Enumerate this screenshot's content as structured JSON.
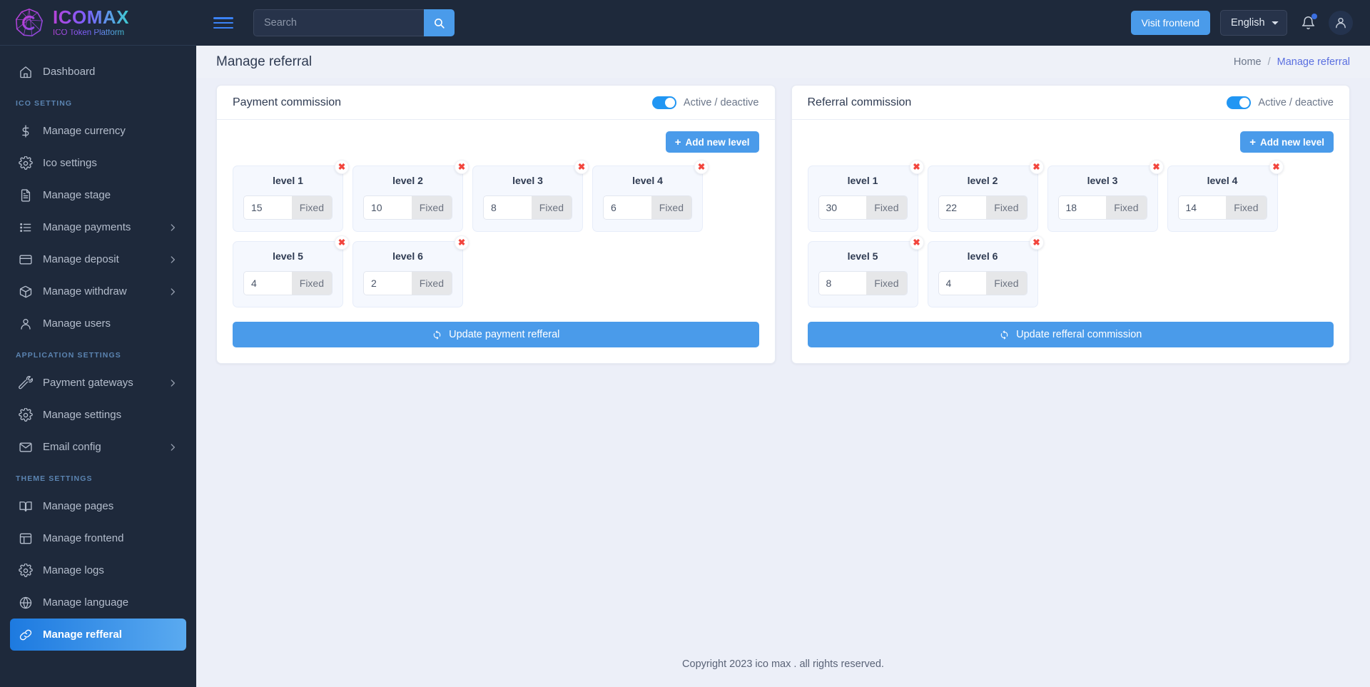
{
  "brand": {
    "title": "ICOMAX",
    "subtitle": "ICO Token Platform",
    "logo_icon": "icomax-gem-logo"
  },
  "sidebar": {
    "items": [
      {
        "label": "Dashboard",
        "icon": "home-icon",
        "type": "item",
        "active": false,
        "caret": false
      },
      {
        "label": "ICO SETTING",
        "type": "section"
      },
      {
        "label": "Manage currency",
        "icon": "dollar-icon",
        "type": "item",
        "active": false,
        "caret": false
      },
      {
        "label": "Ico settings",
        "icon": "gear-icon",
        "type": "item",
        "active": false,
        "caret": false
      },
      {
        "label": "Manage stage",
        "icon": "document-icon",
        "type": "item",
        "active": false,
        "caret": false
      },
      {
        "label": "Manage payments",
        "icon": "list-icon",
        "type": "item",
        "active": false,
        "caret": true
      },
      {
        "label": "Manage deposit",
        "icon": "credit-card-icon",
        "type": "item",
        "active": false,
        "caret": true
      },
      {
        "label": "Manage withdraw",
        "icon": "box-icon",
        "type": "item",
        "active": false,
        "caret": true
      },
      {
        "label": "Manage users",
        "icon": "user-icon",
        "type": "item",
        "active": false,
        "caret": false
      },
      {
        "label": "APPLICATION SETTINGS",
        "type": "section"
      },
      {
        "label": "Payment gateways",
        "icon": "wrench-icon",
        "type": "item",
        "active": false,
        "caret": true
      },
      {
        "label": "Manage settings",
        "icon": "gear-icon",
        "type": "item",
        "active": false,
        "caret": false
      },
      {
        "label": "Email config",
        "icon": "envelope-icon",
        "type": "item",
        "active": false,
        "caret": true
      },
      {
        "label": "THEME SETTINGS",
        "type": "section"
      },
      {
        "label": "Manage pages",
        "icon": "book-icon",
        "type": "item",
        "active": false,
        "caret": false
      },
      {
        "label": "Manage frontend",
        "icon": "layout-icon",
        "type": "item",
        "active": false,
        "caret": false
      },
      {
        "label": "Manage logs",
        "icon": "gear-icon",
        "type": "item",
        "active": false,
        "caret": false
      },
      {
        "label": "Manage language",
        "icon": "globe-icon",
        "type": "item",
        "active": false,
        "caret": false
      },
      {
        "label": "Manage refferal",
        "icon": "link-icon",
        "type": "item",
        "active": true,
        "caret": false
      }
    ]
  },
  "topbar": {
    "menu_toggle_icon": "hamburger-icon",
    "search": {
      "value": "",
      "placeholder": "Search",
      "button_icon": "search-icon"
    },
    "visit_frontend_label": "Visit frontend",
    "language": {
      "selected": "English",
      "options": [
        "English"
      ]
    },
    "notification_icon": "bell-icon",
    "notification_badge": true,
    "profile_icon": "user-avatar-icon"
  },
  "page": {
    "title": "Manage referral",
    "breadcrumb": {
      "home": "Home",
      "separator": "/",
      "current": "Manage referral"
    }
  },
  "cards": [
    {
      "title": "Payment commission",
      "toggle": {
        "active": true,
        "label": "Active / deactive"
      },
      "add_button": {
        "label": "Add new level",
        "icon": "plus-icon"
      },
      "levels": [
        {
          "name": "level 1",
          "value": "15",
          "suffix": "Fixed"
        },
        {
          "name": "level 2",
          "value": "10",
          "suffix": "Fixed"
        },
        {
          "name": "level 3",
          "value": "8",
          "suffix": "Fixed"
        },
        {
          "name": "level 4",
          "value": "6",
          "suffix": "Fixed"
        },
        {
          "name": "level 5",
          "value": "4",
          "suffix": "Fixed"
        },
        {
          "name": "level 6",
          "value": "2",
          "suffix": "Fixed"
        }
      ],
      "update_button": {
        "label": "Update payment refferal",
        "icon": "refresh-icon"
      },
      "remove_icon": "close-x-icon"
    },
    {
      "title": "Referral commission",
      "toggle": {
        "active": true,
        "label": "Active / deactive"
      },
      "add_button": {
        "label": "Add new level",
        "icon": "plus-icon"
      },
      "levels": [
        {
          "name": "level 1",
          "value": "30",
          "suffix": "Fixed"
        },
        {
          "name": "level 2",
          "value": "22",
          "suffix": "Fixed"
        },
        {
          "name": "level 3",
          "value": "18",
          "suffix": "Fixed"
        },
        {
          "name": "level 4",
          "value": "14",
          "suffix": "Fixed"
        },
        {
          "name": "level 5",
          "value": "8",
          "suffix": "Fixed"
        },
        {
          "name": "level 6",
          "value": "4",
          "suffix": "Fixed"
        }
      ],
      "update_button": {
        "label": "Update refferal commission",
        "icon": "refresh-icon"
      },
      "remove_icon": "close-x-icon"
    }
  ],
  "footer": {
    "text": "Copyright 2023 ico max . all rights reserved."
  },
  "colors": {
    "sidebar_bg": "#1e293b",
    "accent_blue": "#4a9bea",
    "toggle_on": "#2196f3",
    "danger_red": "#f2453d",
    "page_bg": "#eef1f8",
    "breadcrumb_link": "#5a6fe0"
  }
}
